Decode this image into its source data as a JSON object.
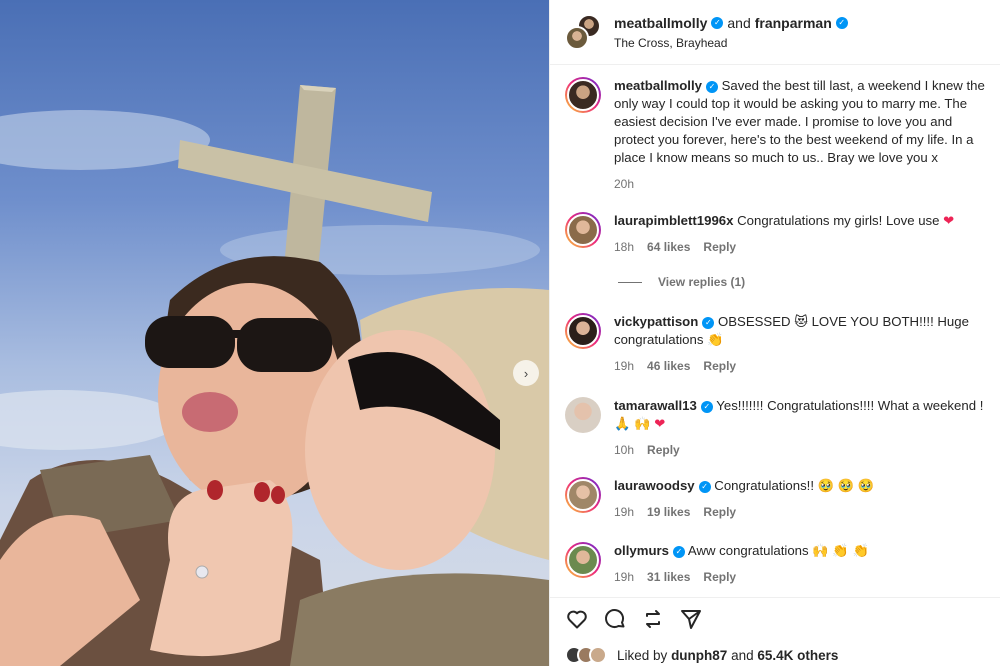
{
  "post": {
    "author": "meatballmolly",
    "conjunction": "and",
    "collaborator": "franparman",
    "location": "The Cross, Brayhead"
  },
  "caption": {
    "user": "meatballmolly",
    "text": "Saved the best till last, a weekend I knew the only way I could top it would be asking you to marry me. The easiest decision I've ever made. I promise to love you and protect you forever, here's to the best weekend of my life. In a place I know means so much to us.. Bray we love you x",
    "time": "20h"
  },
  "comments": [
    {
      "user": "laurapimblett1996x",
      "verified": false,
      "text": "Congratulations my girls! Love use",
      "emoji": "❤",
      "time": "18h",
      "likes": "64 likes",
      "reply": "Reply"
    },
    {
      "user": "vickypattison",
      "verified": true,
      "text": "OBSESSED 😻 LOVE YOU BOTH!!!! Huge congratulations 👏",
      "emoji": "",
      "time": "19h",
      "likes": "46 likes",
      "reply": "Reply"
    },
    {
      "user": "tamarawall13",
      "verified": true,
      "text": "Yes!!!!!!! Congratulations!!!! What a weekend ! 🙏 🙌",
      "emoji": "❤",
      "time": "10h",
      "likes": "",
      "reply": "Reply"
    },
    {
      "user": "laurawoodsy",
      "verified": true,
      "text": "Congratulations!! 🥹 🥹 🥹",
      "emoji": "",
      "time": "19h",
      "likes": "19 likes",
      "reply": "Reply"
    },
    {
      "user": "ollymurs",
      "verified": true,
      "text": "Aww congratulations 🙌 👏 👏",
      "emoji": "",
      "time": "19h",
      "likes": "31 likes",
      "reply": "Reply"
    }
  ],
  "view_replies": "View replies (1)",
  "likes_line": {
    "prefix": "Liked by",
    "user": "dunph87",
    "conjunction": "and",
    "count": "65.4K others"
  },
  "icons": [
    "heart-icon",
    "comment-icon",
    "share-icon",
    "send-icon",
    "verified-icon",
    "chevron-right-icon"
  ],
  "colors": {
    "verified": "#0095f6",
    "muted": "#737373",
    "text": "#262626",
    "heart": "#ed2456"
  }
}
